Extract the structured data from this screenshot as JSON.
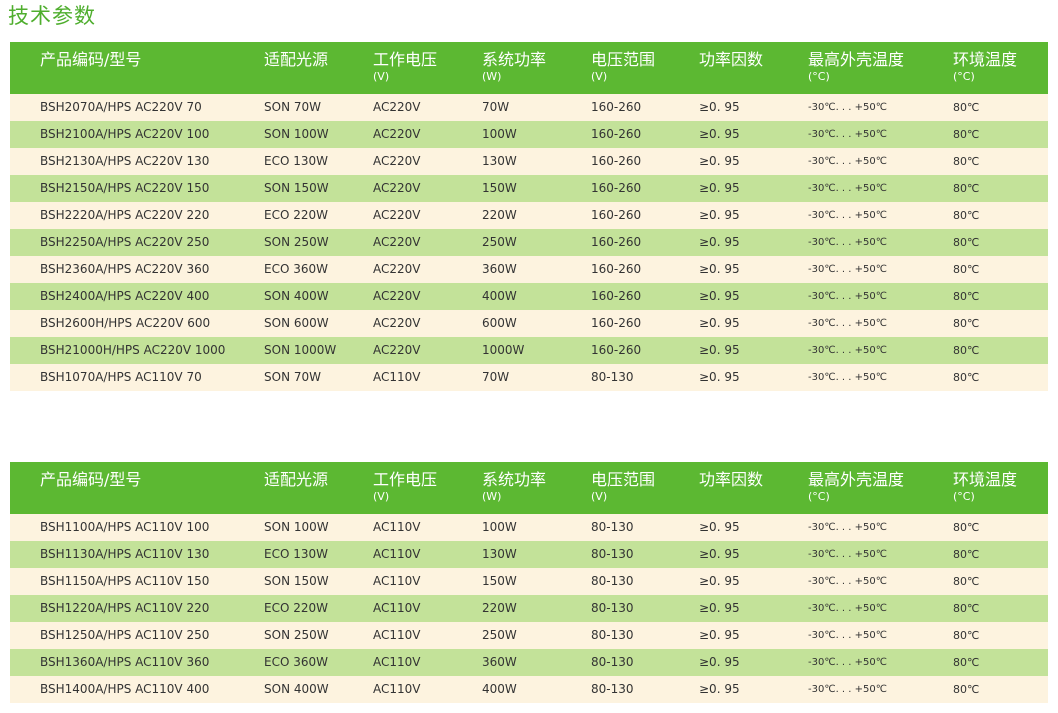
{
  "title": "技术参数",
  "colors": {
    "accent": "#5cb832",
    "title": "#4fae2e",
    "row_light": "#fdf3df",
    "row_green": "#c3e299"
  },
  "columns": [
    {
      "label": "产品编码/型号",
      "unit": ""
    },
    {
      "label": "适配光源",
      "unit": ""
    },
    {
      "label": "工作电压",
      "unit": "(V)"
    },
    {
      "label": "系统功率",
      "unit": "(W)"
    },
    {
      "label": "电压范围",
      "unit": "(V)"
    },
    {
      "label": "功率因数",
      "unit": ""
    },
    {
      "label": "最高外壳温度",
      "unit": "(°C)"
    },
    {
      "label": "环境温度",
      "unit": "(°C)"
    }
  ],
  "table1": {
    "rows": [
      [
        "BSH2070A/HPS  AC220V  70",
        "SON 70W",
        "AC220V",
        "70W",
        "160-260",
        "≥0. 95",
        "-30℃. . . +50℃",
        "80℃"
      ],
      [
        "BSH2100A/HPS  AC220V  100",
        "SON 100W",
        "AC220V",
        "100W",
        "160-260",
        "≥0. 95",
        "-30℃. . . +50℃",
        "80℃"
      ],
      [
        "BSH2130A/HPS  AC220V  130",
        "ECO 130W",
        "AC220V",
        "130W",
        "160-260",
        "≥0. 95",
        "-30℃. . . +50℃",
        "80℃"
      ],
      [
        "BSH2150A/HPS  AC220V  150",
        "SON 150W",
        "AC220V",
        "150W",
        "160-260",
        "≥0. 95",
        "-30℃. . . +50℃",
        "80℃"
      ],
      [
        "BSH2220A/HPS  AC220V  220",
        "ECO 220W",
        "AC220V",
        "220W",
        "160-260",
        "≥0. 95",
        "-30℃. . . +50℃",
        "80℃"
      ],
      [
        "BSH2250A/HPS  AC220V  250",
        "SON 250W",
        "AC220V",
        "250W",
        "160-260",
        "≥0. 95",
        "-30℃. . . +50℃",
        "80℃"
      ],
      [
        "BSH2360A/HPS  AC220V  360",
        "ECO 360W",
        "AC220V",
        "360W",
        "160-260",
        "≥0. 95",
        "-30℃. . . +50℃",
        "80℃"
      ],
      [
        "BSH2400A/HPS  AC220V  400",
        "SON 400W",
        "AC220V",
        "400W",
        "160-260",
        "≥0. 95",
        "-30℃. . . +50℃",
        "80℃"
      ],
      [
        "BSH2600H/HPS  AC220V  600",
        "SON 600W",
        "AC220V",
        "600W",
        "160-260",
        "≥0. 95",
        "-30℃. . . +50℃",
        "80℃"
      ],
      [
        "BSH21000H/HPS  AC220V  1000",
        "SON 1000W",
        "AC220V",
        "1000W",
        "160-260",
        "≥0. 95",
        "-30℃. . . +50℃",
        "80℃"
      ],
      [
        "BSH1070A/HPS  AC110V  70",
        "SON 70W",
        "AC110V",
        "70W",
        "80-130",
        "≥0. 95",
        "-30℃. . . +50℃",
        "80℃"
      ]
    ]
  },
  "table2": {
    "rows": [
      [
        "BSH1100A/HPS  AC110V  100",
        "SON 100W",
        "AC110V",
        "100W",
        "80-130",
        "≥0. 95",
        "-30℃. . . +50℃",
        "80℃"
      ],
      [
        "BSH1130A/HPS  AC110V  130",
        "ECO 130W",
        "AC110V",
        "130W",
        "80-130",
        "≥0. 95",
        "-30℃. . . +50℃",
        "80℃"
      ],
      [
        "BSH1150A/HPS  AC110V  150",
        "SON 150W",
        "AC110V",
        "150W",
        "80-130",
        "≥0. 95",
        "-30℃. . . +50℃",
        "80℃"
      ],
      [
        "BSH1220A/HPS  AC110V  220",
        "ECO 220W",
        "AC110V",
        "220W",
        "80-130",
        "≥0. 95",
        "-30℃. . . +50℃",
        "80℃"
      ],
      [
        "BSH1250A/HPS  AC110V 250",
        "SON 250W",
        "AC110V",
        "250W",
        "80-130",
        "≥0. 95",
        "-30℃. . . +50℃",
        "80℃"
      ],
      [
        "BSH1360A/HPS  AC110V  360",
        "ECO 360W",
        "AC110V",
        "360W",
        "80-130",
        "≥0. 95",
        "-30℃. . . +50℃",
        "80℃"
      ],
      [
        "BSH1400A/HPS  AC110V  400",
        "SON 400W",
        "AC110V",
        "400W",
        "80-130",
        "≥0. 95",
        "-30℃. . . +50℃",
        "80℃"
      ]
    ]
  }
}
